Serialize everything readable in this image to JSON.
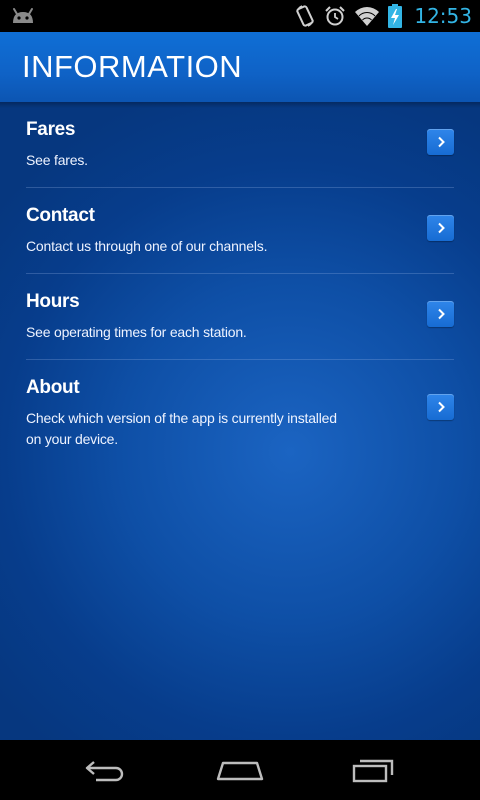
{
  "status_bar": {
    "time": "12:53",
    "icons": [
      "android-notification-icon",
      "rotate-icon",
      "alarm-icon",
      "wifi-icon",
      "battery-charging-icon"
    ],
    "time_color": "#33b5e5"
  },
  "header": {
    "title": "INFORMATION"
  },
  "items": [
    {
      "title": "Fares",
      "description": "See fares."
    },
    {
      "title": "Contact",
      "description": "Contact us through one of our channels."
    },
    {
      "title": "Hours",
      "description": "See operating times for each station."
    },
    {
      "title": "About",
      "description": "Check which version of the app is currently installed on your device."
    }
  ],
  "nav_bar": {
    "buttons": [
      "back-icon",
      "home-icon",
      "recent-apps-icon"
    ]
  },
  "colors": {
    "header_blue": "#0f66cc",
    "background_blue": "#073d8c",
    "arrow_button_blue": "#1f78df"
  }
}
